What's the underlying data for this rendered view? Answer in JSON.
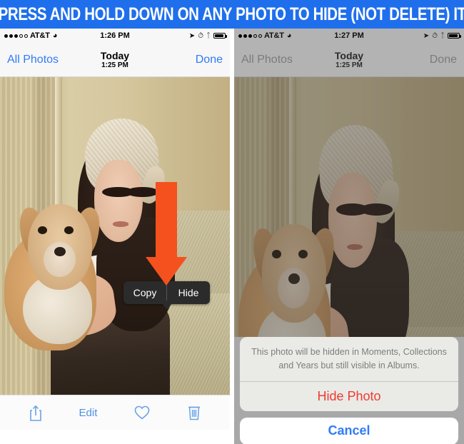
{
  "banner": {
    "text": "PRESS AND HOLD DOWN ON ANY PHOTO TO HIDE (NOT DELETE) IT",
    "background_color": "#1f6fec",
    "text_color": "#ffffff"
  },
  "colors": {
    "ios_blue": "#2f7cf6",
    "ios_red": "#ee3b30",
    "arrow_orange": "#f4511e",
    "context_menu_dark": "#2b2b2b",
    "dimmed_gray": "#b3b3b3"
  },
  "left_phone": {
    "status_bar": {
      "signal_dots_filled": 3,
      "signal_dots_empty": 2,
      "carrier": "AT&T",
      "wifi_icon": "wifi-icon",
      "time": "1:26 PM",
      "location_icon": "location-arrow-icon",
      "alarm_icon": "alarm-clock-icon",
      "bluetooth_icon": "bluetooth-icon",
      "battery_icon": "battery-icon"
    },
    "nav_bar": {
      "back_label": "All Photos",
      "title": "Today",
      "subtitle": "1:25 PM",
      "done_label": "Done"
    },
    "context_menu": {
      "copy_label": "Copy",
      "hide_label": "Hide"
    },
    "toolbar": {
      "share_icon": "share-icon",
      "edit_label": "Edit",
      "favorite_icon": "heart-icon",
      "delete_icon": "trash-icon"
    }
  },
  "right_phone": {
    "status_bar": {
      "signal_dots_filled": 3,
      "signal_dots_empty": 2,
      "carrier": "AT&T",
      "wifi_icon": "wifi-icon",
      "time": "1:27 PM",
      "location_icon": "location-arrow-icon",
      "alarm_icon": "alarm-clock-icon",
      "bluetooth_icon": "bluetooth-icon",
      "battery_icon": "battery-icon"
    },
    "nav_bar": {
      "back_label": "All Photos",
      "title": "Today",
      "subtitle": "1:25 PM",
      "done_label": "Done"
    },
    "action_sheet": {
      "message": "This photo will be hidden in Moments, Collections and Years but still visible in Albums.",
      "hide_label": "Hide Photo",
      "cancel_label": "Cancel"
    }
  }
}
